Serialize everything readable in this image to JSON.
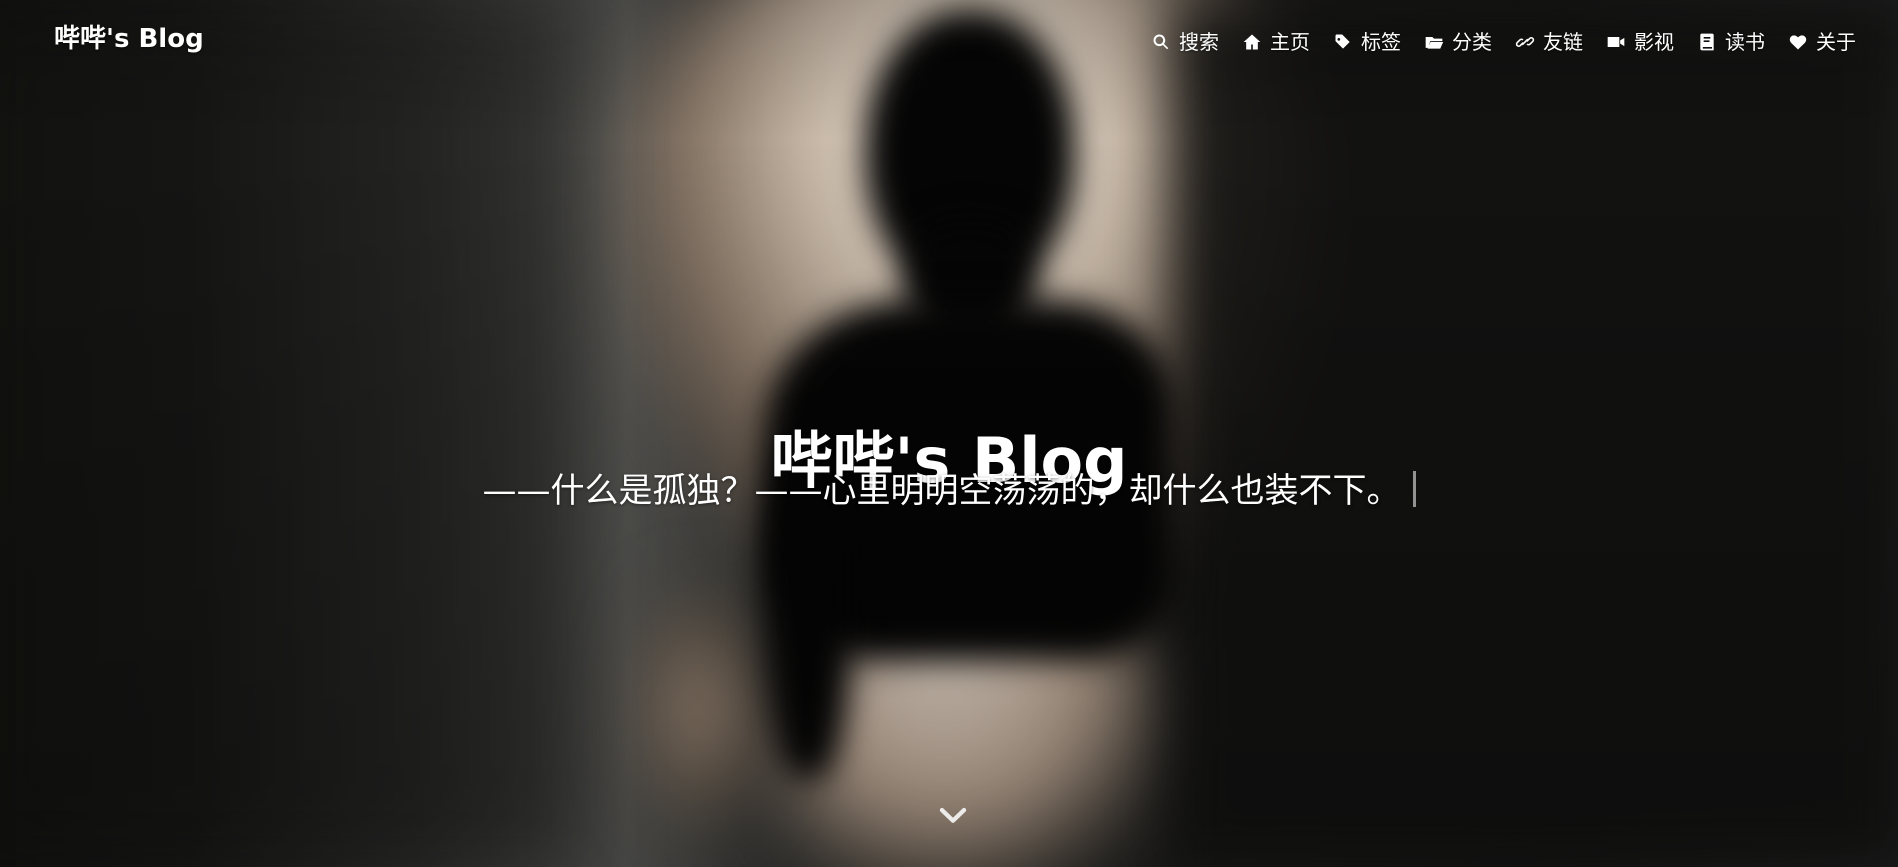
{
  "site": {
    "brand": "哔哔's Blog",
    "title": "哔哔's Blog",
    "subtitle": "——什么是孤独？——心里明明空荡荡的，却什么也装不下。"
  },
  "navigation": [
    {
      "label": "搜索",
      "icon": "search-icon"
    },
    {
      "label": "主页",
      "icon": "home-icon"
    },
    {
      "label": "标签",
      "icon": "tag-icon"
    },
    {
      "label": "分类",
      "icon": "folder-icon"
    },
    {
      "label": "友链",
      "icon": "link-icon"
    },
    {
      "label": "影视",
      "icon": "video-icon"
    },
    {
      "label": "读书",
      "icon": "book-icon"
    },
    {
      "label": "关于",
      "icon": "heart-icon"
    }
  ],
  "scroll_icon": "chevron-down-icon",
  "colors": {
    "text": "#ffffff",
    "background_dark": "#161616",
    "light_wall": "#efe5d8"
  }
}
